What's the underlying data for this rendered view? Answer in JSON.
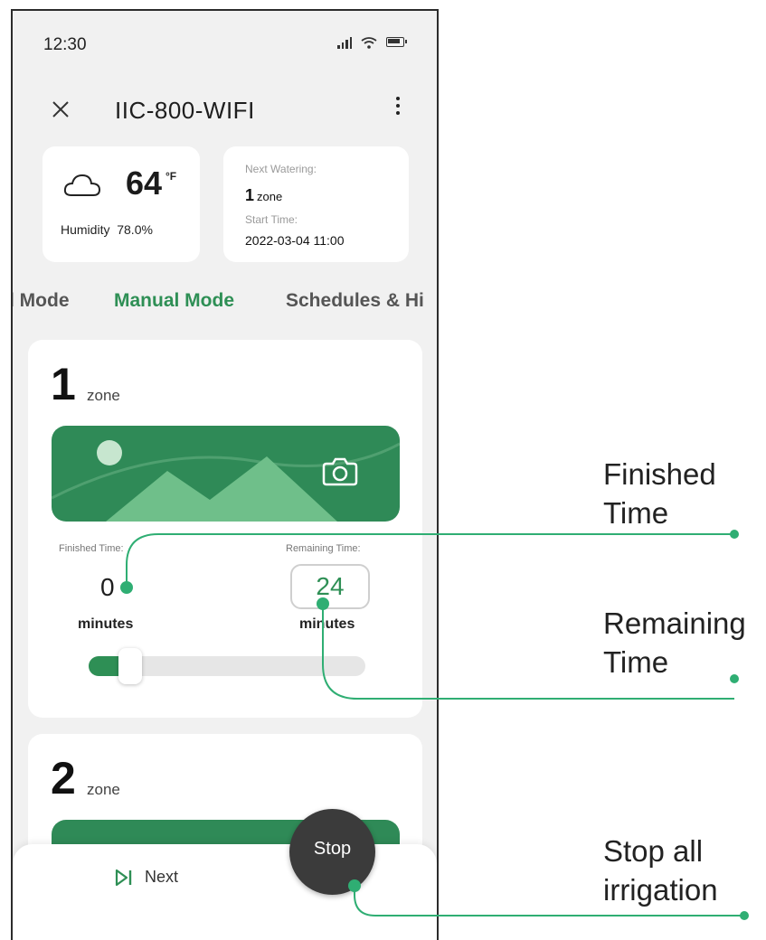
{
  "status_bar": {
    "time": "12:30",
    "icons": [
      "signal-icon",
      "wifi-icon",
      "battery-icon"
    ]
  },
  "header": {
    "title": "IIC-800-WIFI",
    "close_icon": "close-icon",
    "menu_icon": "more-vertical-icon"
  },
  "weather": {
    "icon": "cloud-icon",
    "temperature": "64",
    "unit": "°F",
    "humidity": "Humidity  78.0%"
  },
  "watering": {
    "next_label": "Next Watering:",
    "zone_number": "1",
    "zone_word": "zone",
    "start_label": "Start Time:",
    "start_time": "2022-03-04 11:00"
  },
  "tabs": [
    {
      "label": "l Mode"
    },
    {
      "label": "Manual Mode",
      "active": true
    },
    {
      "label": "Schedules & Hi"
    }
  ],
  "zones": [
    {
      "number": "1",
      "word": "zone",
      "image_icon": "camera-icon",
      "finished_label": "Finished Time:",
      "remaining_label": "Remaining Time:",
      "finished_value": "0",
      "remaining_value": "24",
      "finished_unit": "minutes",
      "remaining_unit": "minutes",
      "progress": 0.12
    },
    {
      "number": "2",
      "word": "zone"
    }
  ],
  "bottom_bar": {
    "next_label": "Next",
    "next_icon": "skip-next-icon",
    "stop_label": "Stop"
  },
  "annotations": {
    "finished": [
      "Finished",
      "Time"
    ],
    "remaining": [
      "Remaining",
      "Time"
    ],
    "stop": [
      "Stop all",
      "irrigation"
    ]
  },
  "colors": {
    "accent": "#2e8f55",
    "image_bg": "#2f8a57",
    "stop_button": "#3b3b3b",
    "screen_bg": "#f1f1f1"
  }
}
